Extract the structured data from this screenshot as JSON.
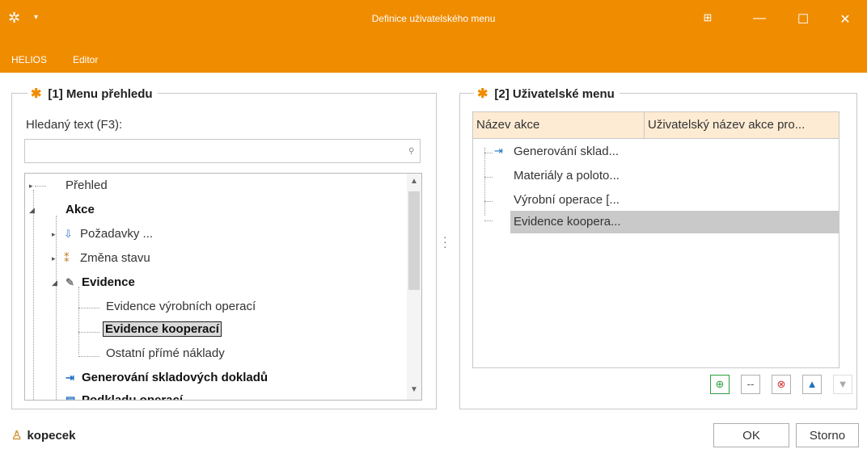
{
  "window": {
    "title": "Definice uživatelského menu",
    "menus": [
      "HELIOS",
      "Editor"
    ]
  },
  "left_panel": {
    "title": "[1] Menu přehledu",
    "search_label": "Hledaný text (F3):",
    "search_value": "",
    "tree": [
      {
        "label": "Přehled",
        "bold": false
      },
      {
        "label": "Akce",
        "bold": true
      },
      {
        "label": "Požadavky ...",
        "bold": false
      },
      {
        "label": "Změna stavu",
        "bold": false
      },
      {
        "label": "Evidence",
        "bold": true
      },
      {
        "label": "Evidence výrobních operací",
        "bold": false
      },
      {
        "label": "Evidence kooperací",
        "bold": true,
        "selected": true
      },
      {
        "label": "Ostatní přímé náklady",
        "bold": false
      },
      {
        "label": "Generování skladových dokladů",
        "bold": true
      },
      {
        "label": "Podkladu operací ...",
        "bold": true
      }
    ]
  },
  "right_panel": {
    "title": "[2] Uživatelské menu",
    "columns": [
      "Název akce",
      "Uživatelský název akce pro..."
    ],
    "rows": [
      {
        "name": "Generování sklad...",
        "user_name": ""
      },
      {
        "name": "Materiály a poloto...",
        "user_name": ""
      },
      {
        "name": "Výrobní operace [...",
        "user_name": ""
      },
      {
        "name": "Evidence koopera...",
        "user_name": "",
        "selected": true
      }
    ],
    "toolbar": [
      "add",
      "separator",
      "delete",
      "move-up",
      "move-down"
    ]
  },
  "status": {
    "user": "kopecek"
  },
  "buttons": {
    "ok": "OK",
    "cancel": "Storno"
  },
  "colors": {
    "accent": "#f08c00",
    "header_bg": "#fdebd3",
    "selection": "#c9c9c9"
  }
}
